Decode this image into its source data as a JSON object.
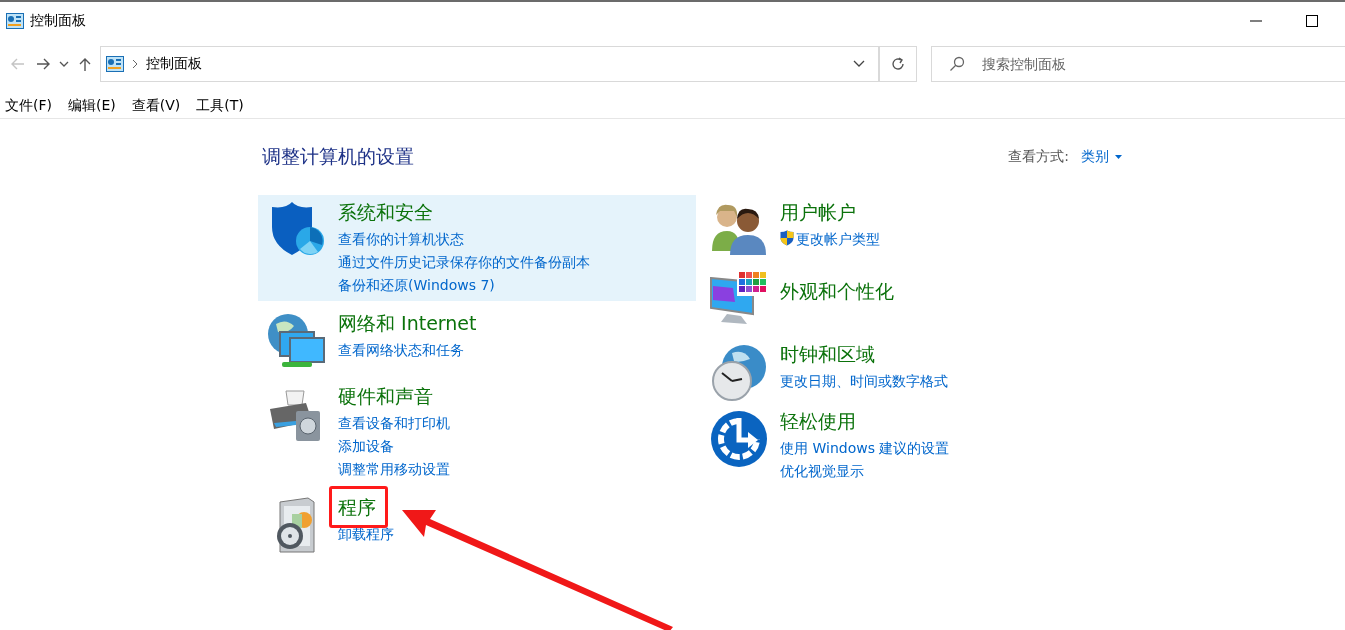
{
  "window": {
    "title": "控制面板"
  },
  "nav": [
    {
      "kind": "back",
      "disabled": true
    },
    {
      "kind": "forward",
      "disabled": false
    },
    {
      "kind": "recent",
      "disabled": false
    },
    {
      "kind": "up",
      "disabled": false
    }
  ],
  "address": {
    "crumbs": [
      "控制面板"
    ]
  },
  "search": {
    "placeholder": "搜索控制面板"
  },
  "menu": [
    "文件(F)",
    "编辑(E)",
    "查看(V)",
    "工具(T)"
  ],
  "heading": "调整计算机的设置",
  "view_by": {
    "label": "查看方式:",
    "value": "类别"
  },
  "columns": [
    {
      "categories": [
        {
          "kind": "security",
          "title": "系统和安全",
          "hovered": true,
          "highlighted": false,
          "links": [
            {
              "text": "查看你的计算机状态",
              "shield": false
            },
            {
              "text": "通过文件历史记录保存你的文件备份副本",
              "shield": false
            },
            {
              "text": "备份和还原(Windows 7)",
              "shield": false
            }
          ]
        },
        {
          "kind": "network",
          "title": "网络和 Internet",
          "hovered": false,
          "highlighted": false,
          "links": [
            {
              "text": "查看网络状态和任务",
              "shield": false
            }
          ]
        },
        {
          "kind": "hardware",
          "title": "硬件和声音",
          "hovered": false,
          "highlighted": false,
          "links": [
            {
              "text": "查看设备和打印机",
              "shield": false
            },
            {
              "text": "添加设备",
              "shield": false
            },
            {
              "text": "调整常用移动设置",
              "shield": false
            }
          ]
        },
        {
          "kind": "programs",
          "title": "程序",
          "hovered": false,
          "highlighted": true,
          "links": [
            {
              "text": "卸载程序",
              "shield": false
            }
          ]
        }
      ]
    },
    {
      "categories": [
        {
          "kind": "users",
          "title": "用户帐户",
          "hovered": false,
          "highlighted": false,
          "links": [
            {
              "text": "更改帐户类型",
              "shield": true
            }
          ]
        },
        {
          "kind": "appearance",
          "title": "外观和个性化",
          "hovered": false,
          "highlighted": false
        },
        {
          "kind": "clock",
          "title": "时钟和区域",
          "hovered": false,
          "highlighted": false,
          "links": [
            {
              "text": "更改日期、时间或数字格式",
              "shield": false
            }
          ]
        },
        {
          "kind": "ease",
          "title": "轻松使用",
          "hovered": false,
          "highlighted": false,
          "links": [
            {
              "text": "使用 Windows 建议的设置",
              "shield": false
            },
            {
              "text": "优化视觉显示",
              "shield": false
            }
          ]
        }
      ]
    }
  ]
}
